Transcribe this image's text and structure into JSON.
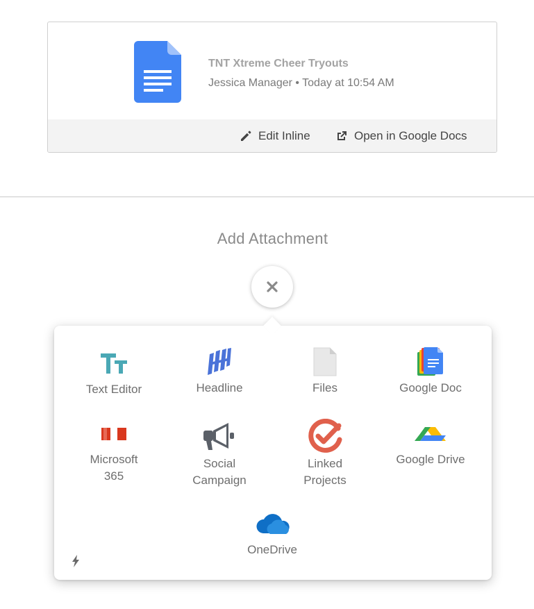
{
  "doc_card": {
    "title": "TNT Xtreme Cheer Tryouts",
    "meta": "Jessica Manager • Today at 10:54 AM",
    "edit_label": "Edit Inline",
    "open_label": "Open in Google Docs"
  },
  "add_attachment": {
    "title": "Add Attachment",
    "options": [
      {
        "label": "Text Editor",
        "icon": "text-editor-icon"
      },
      {
        "label": "Headline",
        "icon": "headline-icon"
      },
      {
        "label": "Files",
        "icon": "file-icon"
      },
      {
        "label": "Google Doc",
        "icon": "google-doc-icon"
      },
      {
        "label": "Microsoft 365",
        "icon": "microsoft-365-icon"
      },
      {
        "label": "Social Campaign",
        "icon": "megaphone-icon"
      },
      {
        "label": "Linked Projects",
        "icon": "linked-projects-icon"
      },
      {
        "label": "Google Drive",
        "icon": "google-drive-icon"
      },
      {
        "label": "OneDrive",
        "icon": "onedrive-icon"
      }
    ]
  },
  "colors": {
    "google_docs_blue": "#4285f4",
    "text_editor_teal": "#4aa8b5",
    "headline_blue": "#4a72d8",
    "linked_projects_red": "#e0604c",
    "microsoft_red": "#d9381e",
    "onedrive_blue": "#0f6fc6"
  }
}
